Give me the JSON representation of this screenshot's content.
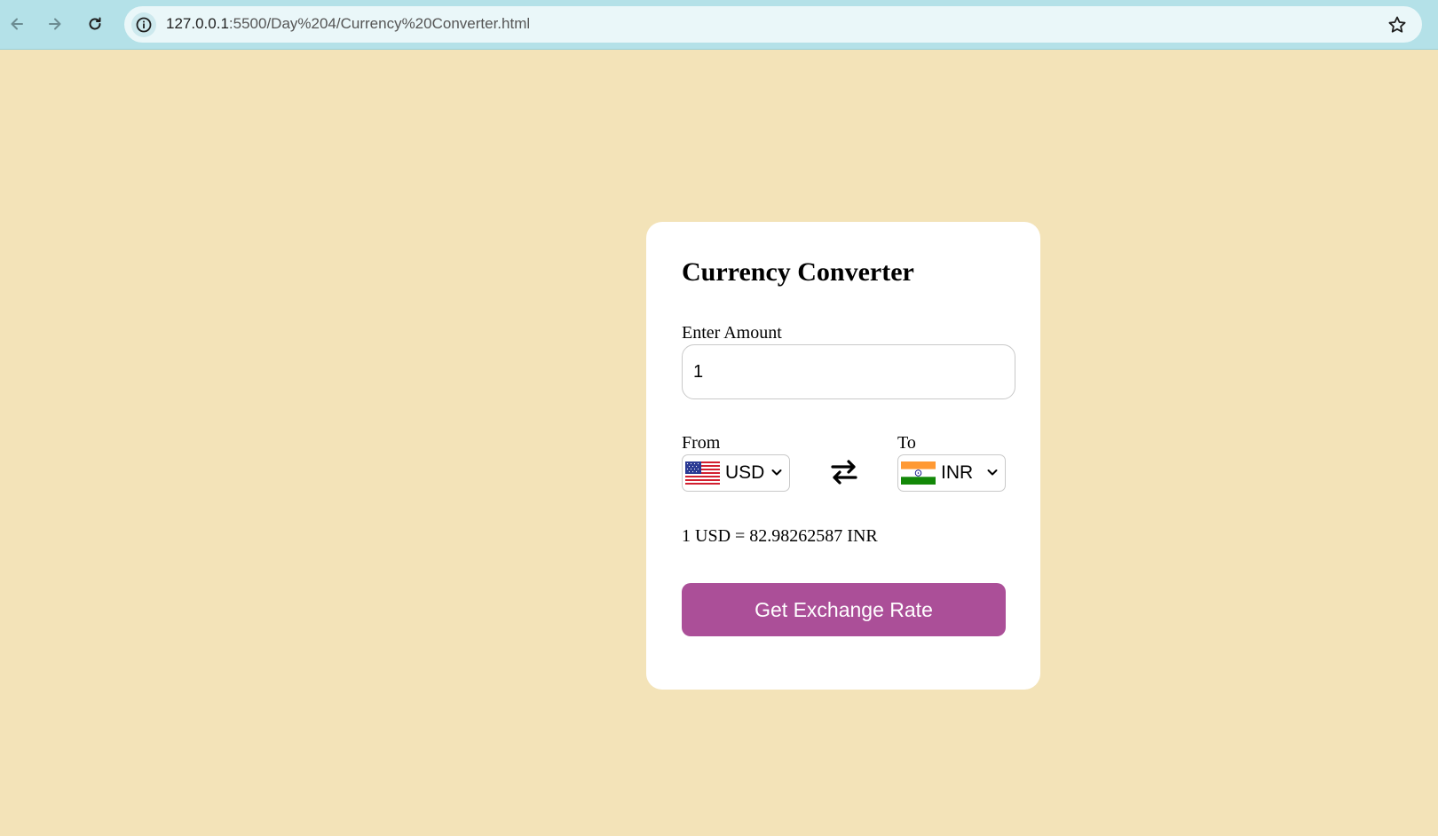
{
  "browser": {
    "url_host": "127.0.0.1",
    "url_path": ":5500/Day%204/Currency%20Converter.html"
  },
  "card": {
    "title": "Currency Converter",
    "amount_label": "Enter Amount",
    "amount_value": "1",
    "from_label": "From",
    "to_label": "To",
    "from_currency": "USD",
    "to_currency": "INR",
    "rate_text": "1 USD = 82.98262587 INR",
    "button_label": "Get Exchange Rate"
  },
  "colors": {
    "page_background": "#f3e3b8",
    "button": "#ab4f98",
    "chrome": "#b4e1e8"
  }
}
